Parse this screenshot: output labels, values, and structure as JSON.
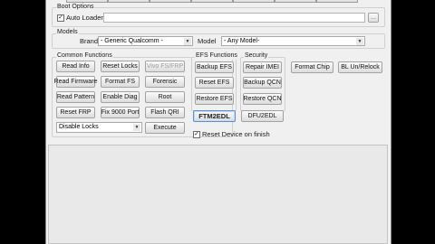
{
  "boot_options": {
    "title": "Boot Options",
    "auto_loader_label": "Auto Loader",
    "auto_loader_checked": true,
    "browse_label": "..."
  },
  "models": {
    "title": "Models",
    "brand_label": "Brand",
    "brand_value": "- Generic Qualcomm -",
    "model_label": "Model",
    "model_value": "- Any Model-"
  },
  "common": {
    "title": "Common Functions",
    "read_info": "Read Info",
    "reset_locks": "Reset Locks",
    "vivo_fs_frp": "Vivo FS/FRP",
    "read_firmware": "Read Firmware",
    "format_fs": "Format FS",
    "forensic": "Forensic",
    "read_pattern": "Read Pattern",
    "enable_diag": "Enable Diag",
    "root": "Root",
    "reset_frp": "Reset FRP",
    "fix_9000_port": "Fix 9000 Port",
    "flash_qri": "Flash QRI",
    "locks_select": "Disable Locks",
    "execute": "Execute"
  },
  "efs": {
    "title": "EFS Functions",
    "backup_efs": "Backup EFS",
    "reset_efs": "Reset EFS",
    "restore_efs": "Restore EFS"
  },
  "security": {
    "title": "Security",
    "repair_imei": "Repair IMEI",
    "backup_qcn": "Backup QCN",
    "restore_qcn": "Restore QCN"
  },
  "extra": {
    "format_chip": "Format Chip",
    "bl_unrelock": "BL Un/Relock"
  },
  "edl": {
    "ftm2edl": "FTM2EDL",
    "dfu2edl": "DFU2EDL"
  },
  "reset_device": {
    "label": "Reset Device on finish",
    "checked": true
  }
}
